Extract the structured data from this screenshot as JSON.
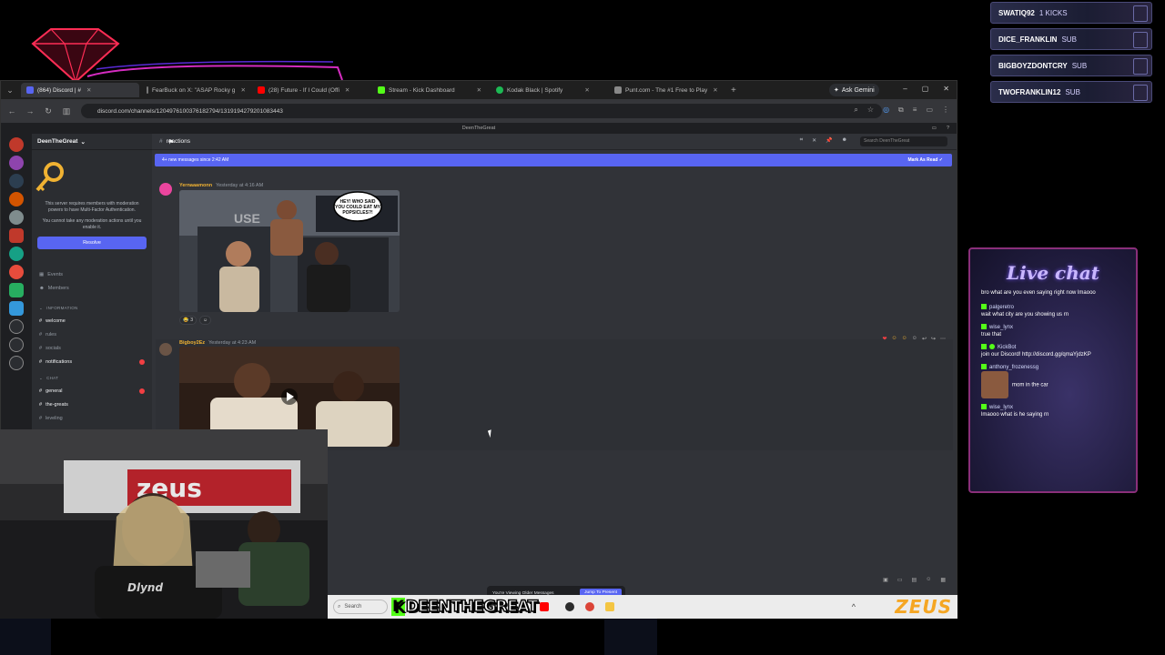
{
  "events": [
    {
      "user": "SWATIQ92",
      "detail": "1 KICKS"
    },
    {
      "user": "DICE_FRANKLIN",
      "detail": "SUB"
    },
    {
      "user": "BIGBOYZDONTCRY",
      "detail": "SUB"
    },
    {
      "user": "TWOFRANKLIN12",
      "detail": "SUB"
    }
  ],
  "browser": {
    "tabs": [
      {
        "label": "(864) Discord | #",
        "color": "#5865f2",
        "active": true
      },
      {
        "label": "FearBuck on X: \"ASAP Rocky g",
        "color": "#000000",
        "active": false
      },
      {
        "label": "(28) Future - If I Could (Offi",
        "color": "#ff0000",
        "active": false
      },
      {
        "label": "Stream - Kick Dashboard",
        "color": "#53fc18",
        "active": false
      },
      {
        "label": "Kodak Black | Spotify",
        "color": "#1db954",
        "active": false
      },
      {
        "label": "Punt.com - The #1 Free to Play",
        "color": "#888888",
        "active": false
      }
    ],
    "ask_label": "Ask Gemini",
    "url": "discord.com/channels/1204976100376182794/1319194279201083443"
  },
  "discord": {
    "window_title": "DeenTheGreat",
    "server_name": "DeenTheGreat",
    "mfa_text_1": "This server requires members with moderation powers to have Multi-Factor Authentication.",
    "mfa_text_2": "You cannot take any moderation actions until you enable it.",
    "resolve_label": "Resolve",
    "nav": [
      {
        "label": "Events"
      },
      {
        "label": "Members"
      }
    ],
    "cat_information": "INFORMATION",
    "channels_info": [
      {
        "name": "welcome",
        "unread": false,
        "bright": true
      },
      {
        "name": "rules",
        "unread": false,
        "bright": false
      },
      {
        "name": "socials",
        "unread": false,
        "bright": false
      },
      {
        "name": "notifications",
        "unread": true,
        "bright": true
      }
    ],
    "cat_chat": "CHAT",
    "channels_chat": [
      {
        "name": "general",
        "unread": true,
        "bright": true
      },
      {
        "name": "the-greats",
        "unread": false,
        "bright": true
      },
      {
        "name": "leveling",
        "unread": false,
        "bright": false
      }
    ],
    "channel_name": "reactions",
    "search_placeholder": "Search DeenTheGreat",
    "new_messages": "4+ new messages since 2:42 AM",
    "mark_as_read": "Mark As Read",
    "messages": [
      {
        "author": "Yernaaamonn",
        "time": "Yesterday at 4:16 AM",
        "caption": "HEY! WHO SAID YOU COULD EAT MY POPSICLES?!",
        "reaction_count": "3"
      },
      {
        "author": "Bigboy2Ez",
        "time": "Yesterday at 4:23 AM"
      }
    ],
    "older_text": "You're Viewing Older Messages",
    "jump_label": "Jump To Present"
  },
  "taskbar": {
    "search_label": "Search",
    "kick_name": "DEENTHEGREAT",
    "zeus": "ZEUS"
  },
  "livechat": {
    "title": "Live chat",
    "messages": [
      {
        "user": "",
        "text": "bro what are you even saying right now lmaooo"
      },
      {
        "user": "palgeretro",
        "text": "wait what city are you showing us rn"
      },
      {
        "user": "wise_lynx",
        "text": "true that"
      },
      {
        "user": "KickBot",
        "text": "join our Discord! http://discord.gg/qmaYjdzKP"
      },
      {
        "user": "anthony_frozenessg",
        "text": "mom in the car"
      },
      {
        "user": "wise_lynx",
        "text": "lmaooo what is he saying rn"
      }
    ]
  },
  "colors": {
    "discord_blurple": "#5865f2",
    "kick_green": "#53fc18",
    "author_gold": "#f0b232"
  }
}
